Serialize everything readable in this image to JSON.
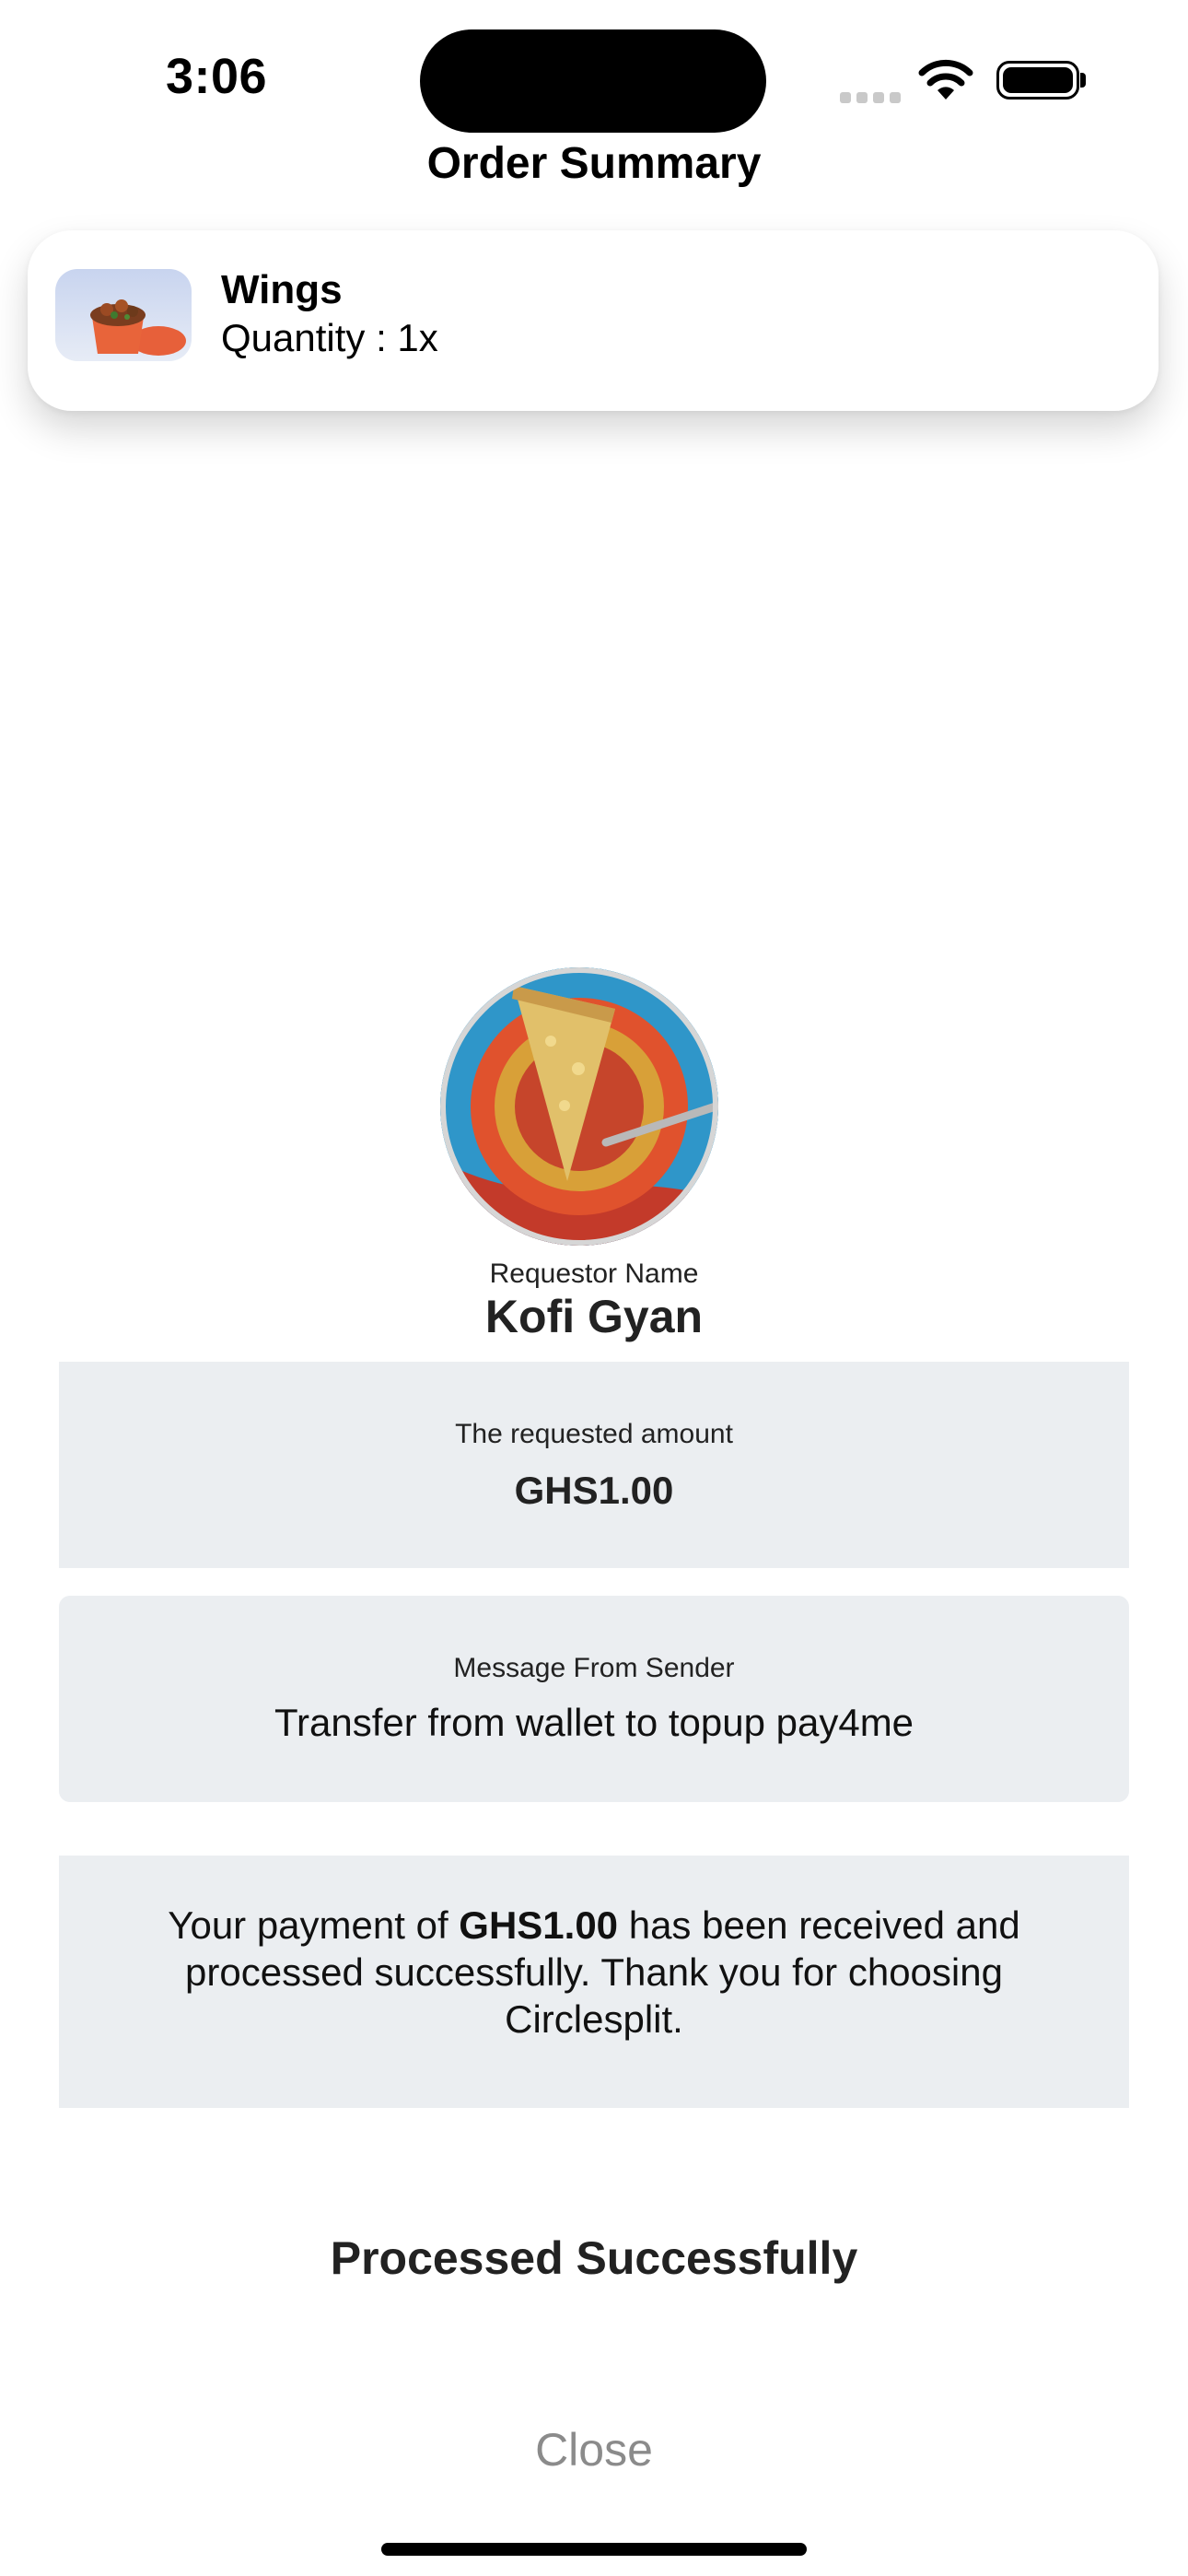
{
  "status_bar": {
    "time": "3:06",
    "signal_icon": "cellular-signal-icon",
    "wifi_icon": "wifi-icon",
    "battery_icon": "battery-icon"
  },
  "header": {
    "title": "Order Summary"
  },
  "order": {
    "item_image_icon": "food-thumbnail",
    "item_name": "Wings",
    "quantity_text": "Quantity : 1x"
  },
  "requestor": {
    "avatar_icon": "pie-avatar",
    "label": "Requestor Name",
    "name": "Kofi Gyan"
  },
  "amount": {
    "label": "The requested amount",
    "value": "GHS1.00"
  },
  "message": {
    "label": "Message From Sender",
    "value": "Transfer from wallet to topup pay4me"
  },
  "confirmation": {
    "prefix": "Your payment of ",
    "amount": "GHS1.00",
    "suffix": " has been received and processed successfully. Thank you for choosing Circlesplit."
  },
  "status": {
    "text": "Processed Successfully"
  },
  "actions": {
    "close_label": "Close"
  },
  "colors": {
    "panel_background": "#ebeef1",
    "close_text": "#8b8b8b"
  }
}
